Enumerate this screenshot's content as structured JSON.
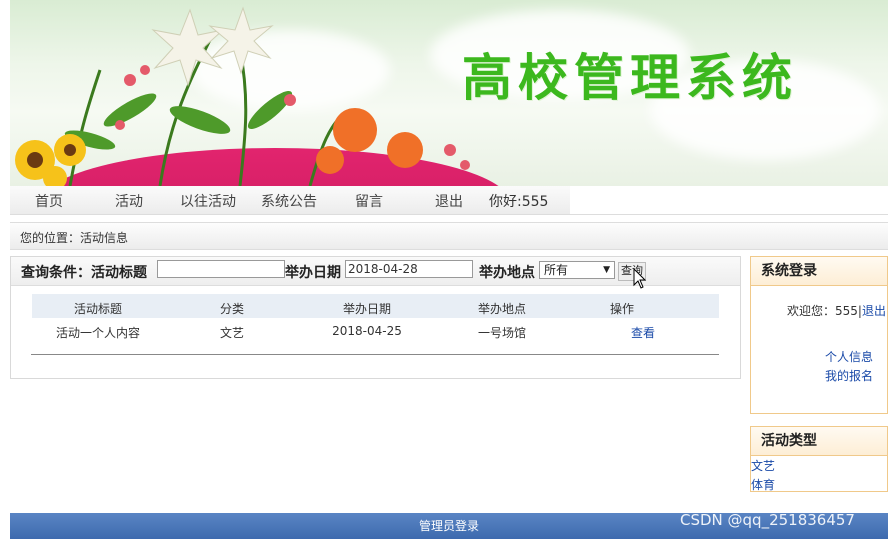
{
  "banner": {
    "site_title": "高校管理系统"
  },
  "nav": {
    "items": [
      "首页",
      "活动",
      "以往活动",
      "系统公告",
      "留言",
      "退出"
    ],
    "greeting": "你好:555"
  },
  "breadcrumb": "您的位置：活动信息",
  "query": {
    "label_conditions": "查询条件：活动标题",
    "title_value": "",
    "label_date": "举办日期",
    "date_value": "2018-04-28",
    "label_location": "举办地点",
    "location_selected": "所有",
    "search_button": "查询"
  },
  "table": {
    "headers": [
      "活动标题",
      "分类",
      "举办日期",
      "举办地点",
      "操作"
    ],
    "rows": [
      [
        "活动一个人内容",
        "文艺",
        "2018-04-25",
        "一号场馆",
        "查看"
      ]
    ]
  },
  "login_panel": {
    "title": "系统登录",
    "welcome": "欢迎您：555|",
    "logout": "退出",
    "links": [
      "个人信息",
      "我的报名"
    ]
  },
  "category_panel": {
    "title": "活动类型",
    "items": [
      "文艺",
      "体育"
    ]
  },
  "footer": {
    "admin_login": "管理员登录"
  },
  "watermark": "CSDN @qq_251836457",
  "colors": {
    "title_green": "#3cb81e",
    "footer_blue": "#4a76b8",
    "link_blue": "#1a4aa8",
    "panel_border": "#f0c98a"
  }
}
